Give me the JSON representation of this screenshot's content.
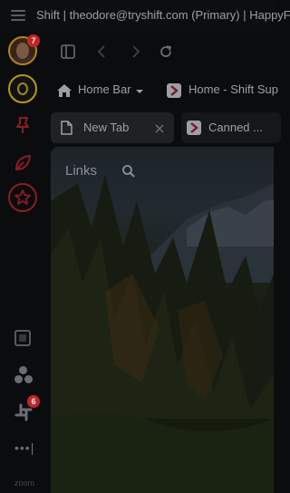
{
  "window": {
    "title": "Shift | theodore@tryshift.com (Primary) | HappyFox"
  },
  "sidebar": {
    "accounts": [
      {
        "name": "avatar-account-1",
        "badge": "7"
      },
      {
        "name": "avatar-account-2",
        "badge": ""
      }
    ],
    "slack_badge": "6",
    "more_label": "•••|",
    "zoom_label": "zoom"
  },
  "bookmarks": [
    {
      "label": "Home Bar",
      "icon": "home-icon"
    },
    {
      "label": "Home - Shift Sup",
      "icon": "shift-logo-icon"
    }
  ],
  "tabs": [
    {
      "label": "New Tab",
      "active": true
    },
    {
      "label": "Canned ...",
      "active": false
    }
  ],
  "content": {
    "links_label": "Links"
  },
  "colors": {
    "background": "#0b0c0e",
    "badge": "#c0262a",
    "text": "#9ca0a6"
  }
}
